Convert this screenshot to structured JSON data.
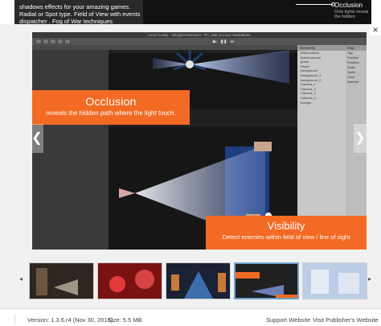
{
  "header": {
    "description": "shadows effects for your amazing games. Radial or Spot type. Field of View with events dispatcher . Fog of War techniques",
    "preview_caption": "Occlusion",
    "preview_subcaption": "Only lights reveal the hidden"
  },
  "viewer": {
    "editor_title": "Level 2.unity - 2dLightAssetStore - PC, Mac & Linux Standalone",
    "editor_tabs": [
      "Profiler",
      "Animator",
      "Scene"
    ],
    "hierarchy_title": "Hierarchy",
    "hierarchy_items": [
      "MainCamera",
      "MainCamera2",
      "ghost",
      "Player",
      "background",
      "background_1",
      "background_2",
      "Camera_1",
      "Camera_2",
      "Camera_3",
      "Camera_4",
      "triangle"
    ],
    "inspector_title": "Insp",
    "inspector_items": [
      "Tag",
      "Position",
      "Rotation",
      "Scale",
      "Sprite",
      "Color",
      "Material"
    ],
    "occlusion_title": "Occlusion",
    "occlusion_desc": "reveals the hidden path where the light touch.",
    "visibility_title": "Visibility",
    "visibility_desc": "Detect enemies within field of view / line of sight",
    "close_symbol": "×",
    "prev_symbol": "❮",
    "next_symbol": "❯"
  },
  "thumbnails": {
    "prev_symbol": "◂",
    "next_symbol": "▸",
    "items": [
      {
        "name": "thumb-1",
        "selected": false
      },
      {
        "name": "thumb-2",
        "selected": false
      },
      {
        "name": "thumb-3",
        "selected": false
      },
      {
        "name": "thumb-4",
        "selected": true
      },
      {
        "name": "thumb-5",
        "selected": false
      }
    ]
  },
  "footer": {
    "version": "Version: 1.3.6.r4 (Nov 30, 2016)",
    "size": "Size: 5.5 MB",
    "support": "Support Website",
    "publisher": "Visit Publisher's Website"
  },
  "colors": {
    "accent_orange": "#f26a23",
    "selection_blue": "#6fa3cf",
    "light_cone": "#8aa6e6"
  }
}
